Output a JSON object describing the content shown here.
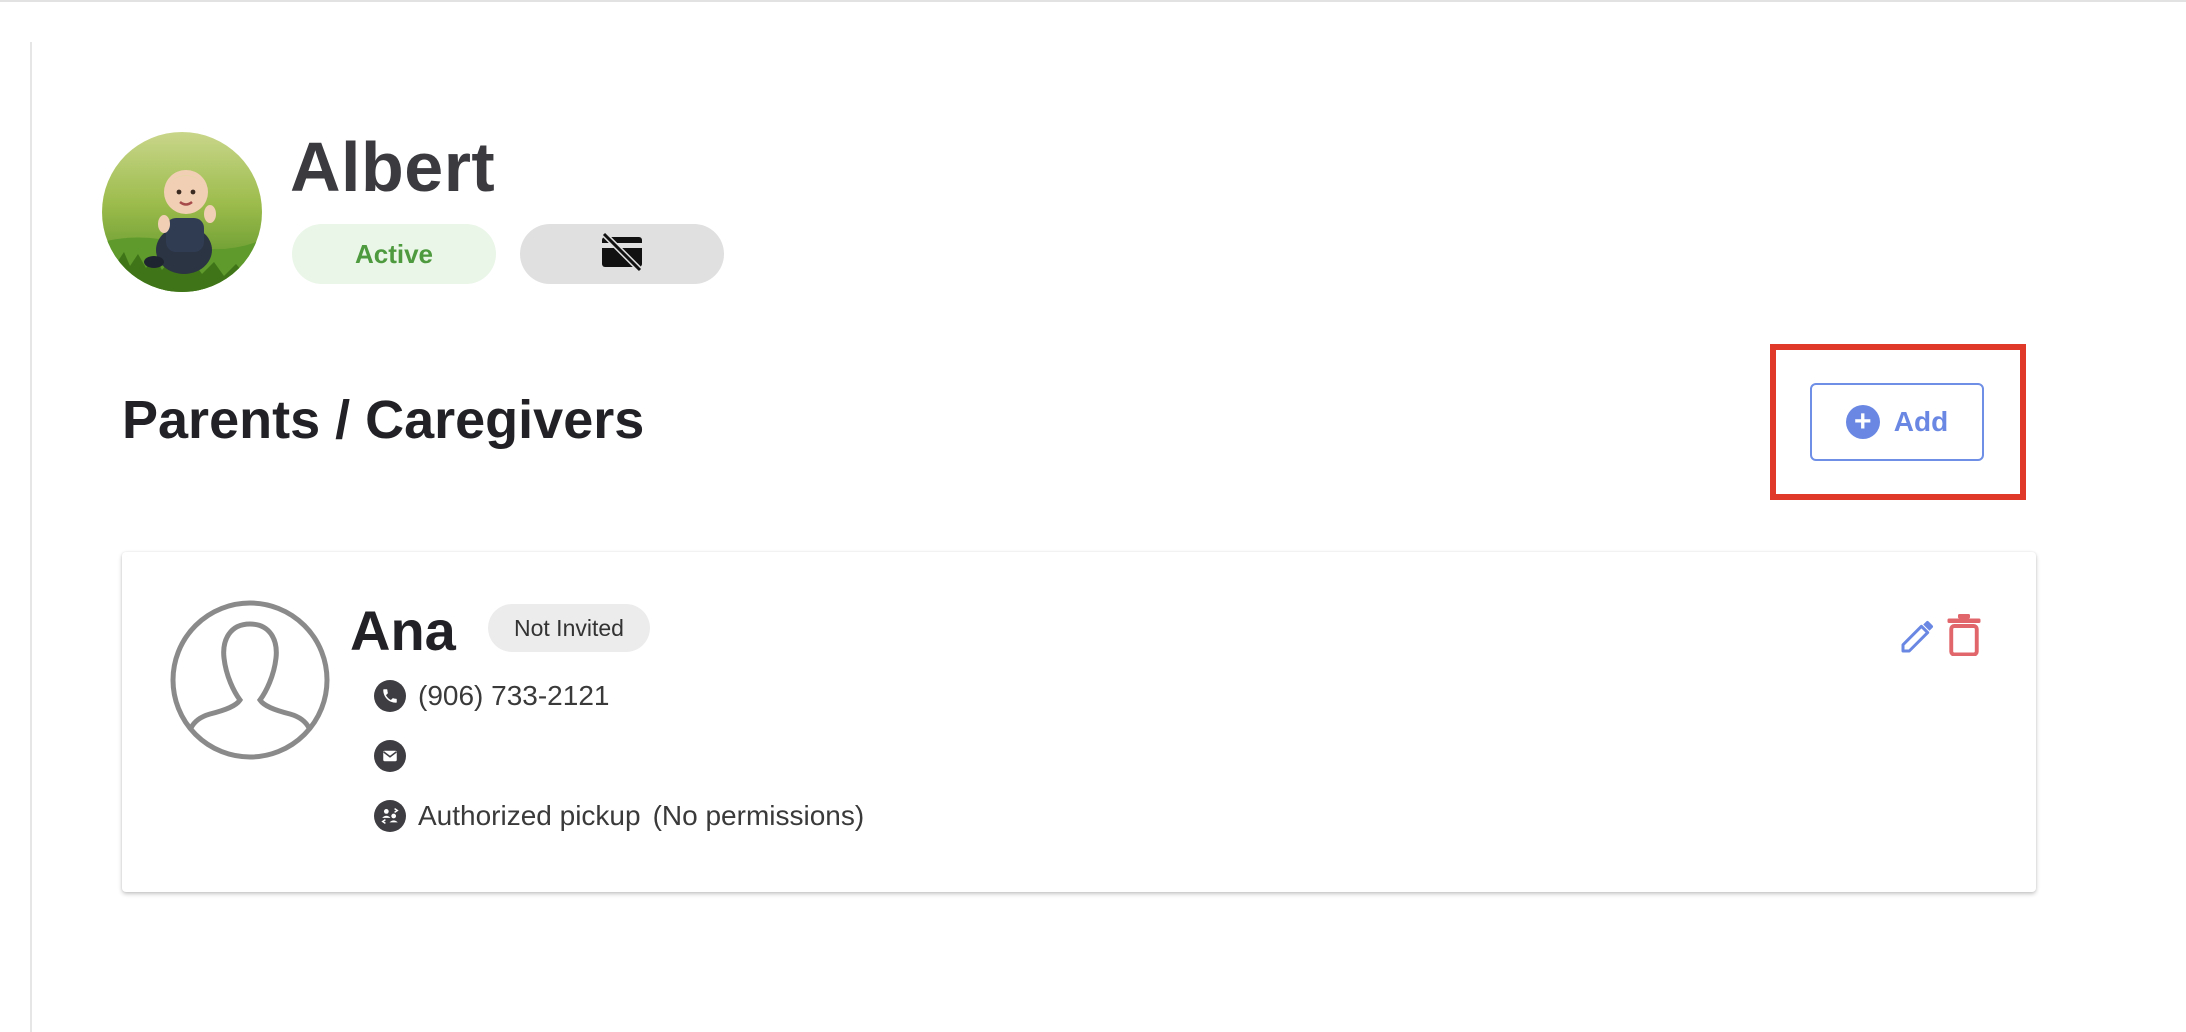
{
  "child": {
    "name": "Albert",
    "status": "Active",
    "card_icon": "no-card-icon",
    "avatar_icon": "child-photo"
  },
  "section": {
    "title": "Parents / Caregivers",
    "add_label": "Add",
    "add_icon": "plus-circle-icon"
  },
  "caregivers": [
    {
      "name": "Ana",
      "invite_status": "Not Invited",
      "phone": "(906) 733-2121",
      "email": "",
      "permissions_label": "Authorized pickup",
      "permissions_detail": "(No permissions)",
      "actions": [
        "edit-icon",
        "delete-icon"
      ]
    }
  ],
  "colors": {
    "active_text": "#4e9a3e",
    "active_bg": "#eaf6e8",
    "accent_blue": "#6a88e3",
    "delete_red": "#e0666b",
    "highlight_red": "#e0392a"
  }
}
